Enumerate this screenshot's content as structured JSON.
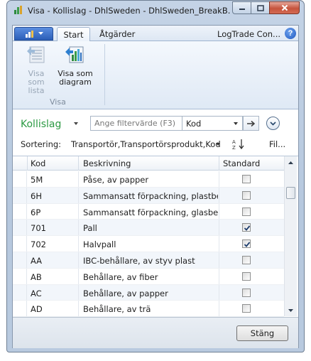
{
  "window": {
    "title": "Visa - Kollislag - DhlSweden - DhlSweden_BreakB...",
    "minimize_label": "",
    "close_label": ""
  },
  "ribbon": {
    "tabs": [
      {
        "label": "Start",
        "active": true
      },
      {
        "label": "Åtgärder",
        "active": false
      },
      {
        "label": "LogTrade Con...",
        "active": false
      }
    ],
    "group": {
      "label": "Visa",
      "buttons": [
        {
          "label_line1": "Visa",
          "label_line2": "som lista",
          "icon": "list-view-icon",
          "enabled": false
        },
        {
          "label_line1": "Visa som",
          "label_line2": "diagram",
          "icon": "chart-view-icon",
          "enabled": true
        }
      ]
    },
    "help_glyph": "?"
  },
  "filter": {
    "page_title": "Kollislag",
    "placeholder": "Ange filtervärde (F3)",
    "field": "Kod"
  },
  "sorting": {
    "label": "Sortering:",
    "value": "Transportör,Transportörsprodukt,Kod",
    "filter_link": "Fil..."
  },
  "grid": {
    "columns": [
      "Kod",
      "Beskrivning",
      "Standard"
    ],
    "rows": [
      {
        "kod": "5M",
        "beskrivning": "Påse, av papper",
        "standard": false
      },
      {
        "kod": "6H",
        "beskrivning": "Sammansatt förpackning, plastbe...",
        "standard": false
      },
      {
        "kod": "6P",
        "beskrivning": "Sammansatt förpackning, glasbe...",
        "standard": false
      },
      {
        "kod": "701",
        "beskrivning": "Pall",
        "standard": true
      },
      {
        "kod": "702",
        "beskrivning": "Halvpall",
        "standard": true
      },
      {
        "kod": "AA",
        "beskrivning": "IBC-behållare, av styv plast",
        "standard": false
      },
      {
        "kod": "AB",
        "beskrivning": "Behållare, av fiber",
        "standard": false
      },
      {
        "kod": "AC",
        "beskrivning": "Behållare, av papper",
        "standard": false
      },
      {
        "kod": "AD",
        "beskrivning": "Behållare, av trä",
        "standard": false
      }
    ]
  },
  "footer": {
    "close_label": "Stäng"
  },
  "colors": {
    "page_title": "#2c9a43",
    "app_menu": "#2b5eb8",
    "close_button": "#c6543d"
  }
}
